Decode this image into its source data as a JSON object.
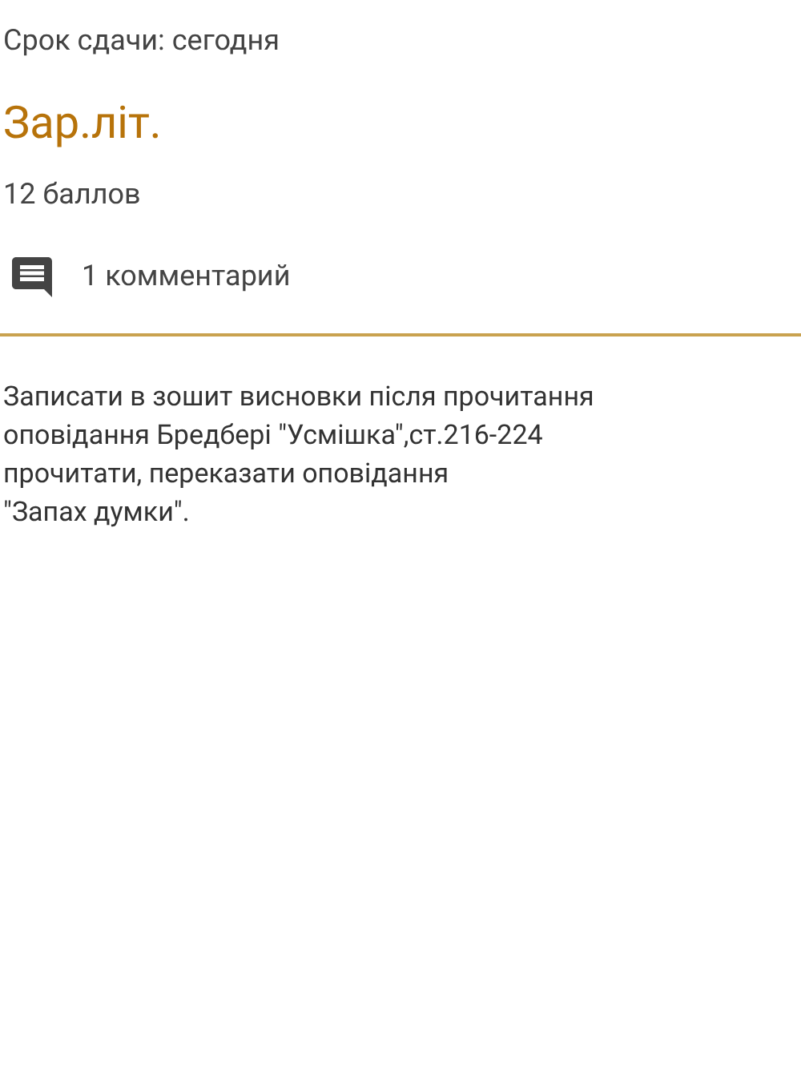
{
  "due": "Срок сдачи: сегодня",
  "title": "Зар.літ.",
  "points": "12 баллов",
  "comments": "1 комментарий",
  "description": "Записати в зошит висновки після прочитання\nоповідання Бредбері \"Усмішка\",ст.216-224\nпрочитати, переказати оповідання\n\"Запах думки\"."
}
